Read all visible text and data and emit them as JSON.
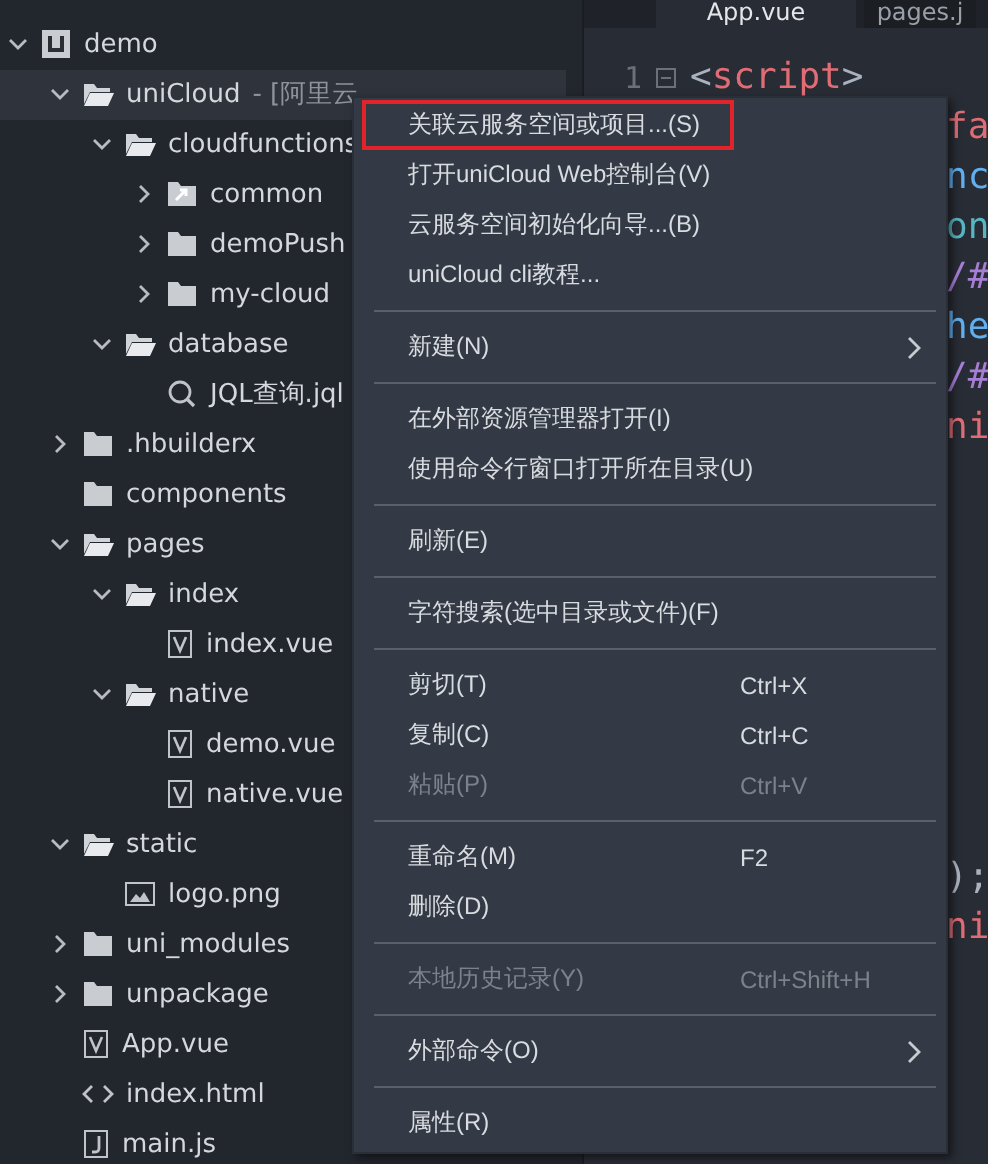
{
  "tree": [
    {
      "label": "demo",
      "kind": "project",
      "expanded": true,
      "selected": false,
      "children": [
        {
          "label": "uniCloud",
          "note": "- [阿里云",
          "kind": "cloud",
          "expanded": true,
          "selected": true,
          "children": [
            {
              "label": "cloudfunctions",
              "kind": "folder",
              "expanded": true,
              "selected": false,
              "children": [
                {
                  "label": "common",
                  "kind": "linkfolder",
                  "expanded": false,
                  "selected": false
                },
                {
                  "label": "demoPush",
                  "kind": "folder",
                  "expanded": false,
                  "selected": false
                },
                {
                  "label": "my-cloud",
                  "kind": "folder",
                  "expanded": false,
                  "selected": false
                }
              ]
            },
            {
              "label": "database",
              "kind": "folder",
              "expanded": true,
              "selected": false,
              "children": [
                {
                  "label": "JQL查询.jql",
                  "kind": "jql",
                  "selected": false
                }
              ]
            }
          ]
        },
        {
          "label": ".hbuilderx",
          "kind": "folder",
          "expanded": false,
          "selected": false
        },
        {
          "label": "components",
          "kind": "folder",
          "selected": false
        },
        {
          "label": "pages",
          "kind": "folder",
          "expanded": true,
          "selected": false,
          "children": [
            {
              "label": "index",
              "kind": "folder",
              "expanded": true,
              "selected": false,
              "children": [
                {
                  "label": "index.vue",
                  "kind": "vue",
                  "selected": false
                }
              ]
            },
            {
              "label": "native",
              "kind": "folder",
              "expanded": true,
              "selected": false,
              "children": [
                {
                  "label": "demo.vue",
                  "kind": "vue",
                  "selected": false
                },
                {
                  "label": "native.vue",
                  "kind": "vue",
                  "selected": false
                }
              ]
            }
          ]
        },
        {
          "label": "static",
          "kind": "folder",
          "expanded": true,
          "selected": false,
          "children": [
            {
              "label": "logo.png",
              "kind": "image",
              "selected": false
            }
          ]
        },
        {
          "label": "uni_modules",
          "kind": "folder",
          "expanded": false,
          "selected": false
        },
        {
          "label": "unpackage",
          "kind": "folder",
          "expanded": false,
          "selected": false
        },
        {
          "label": "App.vue",
          "kind": "vue",
          "selected": false
        },
        {
          "label": "index.html",
          "kind": "html",
          "selected": false
        },
        {
          "label": "main.js",
          "kind": "js",
          "selected": false
        }
      ]
    }
  ],
  "tabs": [
    {
      "label": "App.vue",
      "selected": true
    },
    {
      "label": "pages.j",
      "selected": false
    }
  ],
  "editor": {
    "line_number": "1",
    "first_line": [
      {
        "text": "<",
        "color": "#abb2bf"
      },
      {
        "text": "script",
        "color": "#e06c75"
      },
      {
        "text": ">",
        "color": "#abb2bf"
      }
    ],
    "fragments": [
      [
        {
          "text": "fa",
          "color": "#e06c75"
        },
        {
          "text": "nc",
          "color": "#61afef"
        },
        {
          "text": "on",
          "color": "#56b6c2"
        },
        {
          "text": "/#",
          "color": "#a77ed6"
        },
        {
          "text": "he",
          "color": "#61afef"
        },
        {
          "text": "/#",
          "color": "#a77ed6"
        },
        {
          "text": "ni",
          "color": "#e06c75"
        }
      ],
      [
        {
          "text": ");",
          "color": "#abb2bf"
        },
        {
          "text": "ni",
          "color": "#e06c75"
        }
      ]
    ]
  },
  "context_menu": [
    [
      {
        "label": "关联云服务空间或项目...(S)",
        "outlined": true,
        "disabled": false
      },
      {
        "label": "打开uniCloud Web控制台(V)",
        "outlined": false,
        "disabled": false
      },
      {
        "label": "云服务空间初始化向导...(B)",
        "outlined": false,
        "disabled": false
      },
      {
        "label": "uniCloud cli教程...",
        "outlined": false,
        "disabled": false
      }
    ],
    [
      {
        "label": "新建(N)",
        "outlined": false,
        "disabled": false,
        "submenu": true
      }
    ],
    [
      {
        "label": "在外部资源管理器打开(I)",
        "outlined": false,
        "disabled": false
      },
      {
        "label": "使用命令行窗口打开所在目录(U)",
        "outlined": false,
        "disabled": false
      }
    ],
    [
      {
        "label": "刷新(E)",
        "outlined": false,
        "disabled": false
      }
    ],
    [
      {
        "label": "字符搜索(选中目录或文件)(F)",
        "outlined": false,
        "disabled": false
      }
    ],
    [
      {
        "label": "剪切(T)",
        "shortcut": "Ctrl+X",
        "outlined": false,
        "disabled": false
      },
      {
        "label": "复制(C)",
        "shortcut": "Ctrl+C",
        "outlined": false,
        "disabled": false
      },
      {
        "label": "粘贴(P)",
        "shortcut": "Ctrl+V",
        "outlined": false,
        "disabled": true
      }
    ],
    [
      {
        "label": "重命名(M)",
        "shortcut": "F2",
        "outlined": false,
        "disabled": false
      },
      {
        "label": "删除(D)",
        "outlined": false,
        "disabled": false
      }
    ],
    [
      {
        "label": "本地历史记录(Y)",
        "shortcut": "Ctrl+Shift+H",
        "outlined": false,
        "disabled": true
      }
    ],
    [
      {
        "label": "外部命令(O)",
        "outlined": false,
        "disabled": false,
        "submenu": true
      }
    ],
    [
      {
        "label": "属性(R)",
        "outlined": false,
        "disabled": false
      }
    ]
  ]
}
